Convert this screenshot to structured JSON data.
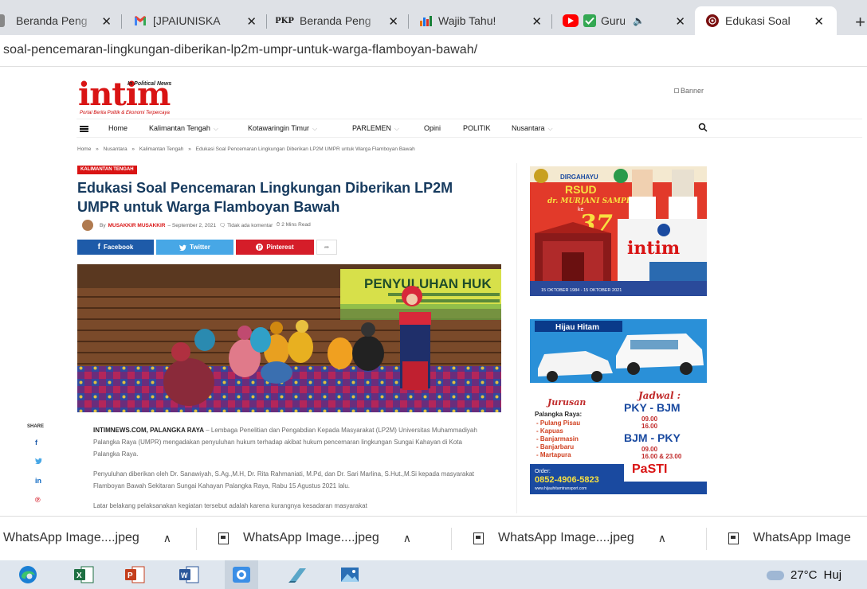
{
  "browser": {
    "tabs": [
      {
        "title": "Beranda Peng",
        "favicon": "gear-icon",
        "color": "#888888"
      },
      {
        "title": "[JPAIUNISKA",
        "favicon": "gmail-icon",
        "color": "#ea4335"
      },
      {
        "title": "Beranda Peng",
        "favicon": "pkp-icon",
        "favicon_text": "PKP",
        "color": "#222222"
      },
      {
        "title": "Wajib Tahu!",
        "favicon": "chart-icon",
        "color": "#e8710a"
      },
      {
        "title": "Guru",
        "favicon": "youtube-icon",
        "color": "#ff0000",
        "sound": "🔈"
      },
      {
        "title": "Edukasi Soal",
        "favicon": "site-icon",
        "color": "#7a1010"
      }
    ],
    "close_glyph": "✕",
    "new_tab_glyph": "+",
    "url": "soal-pencemaran-lingkungan-diberikan-lp2m-umpr-untuk-warga-flamboyan-bawah/"
  },
  "site": {
    "logo_text": "intim",
    "logo_small": "In Political News",
    "logo_tagline": "Portal Berita Politik & Ekonomi Terpercaya",
    "banner_alt": "Banner",
    "nav": [
      {
        "label": "Home",
        "caret": false
      },
      {
        "label": "Kalimantan Tengah",
        "caret": true
      },
      {
        "label": "Kotawaringin Timur",
        "caret": true
      },
      {
        "label": "PARLEMEN",
        "caret": true
      },
      {
        "label": "Opini",
        "caret": false
      },
      {
        "label": "POLITIK",
        "caret": false
      },
      {
        "label": "Nusantara",
        "caret": true
      }
    ],
    "nav_caret": "⌵"
  },
  "article": {
    "breadcrumb": [
      "Home",
      "»",
      "Nusantara",
      "»",
      "Kalimantan Tengah",
      "»",
      "Edukasi Soal Pencemaran Lingkungan Diberikan LP2M UMPR untuk Warga Flamboyan Bawah"
    ],
    "category": "KALIMANTAN TENGAH",
    "title": "Edukasi Soal Pencemaran Lingkungan Diberikan LP2M UMPR untuk Warga Flamboyan Bawah",
    "by": "By",
    "author": "MUSAKKIR MUSAKKIR",
    "date": "– September 2, 2021",
    "comments": "🗨 Tidak ada komentar",
    "read_time": "⏱ 2 Mins Read",
    "share": {
      "facebook": "Facebook",
      "twitter": "Twitter",
      "pinterest": "Pinterest",
      "more": "➦"
    },
    "share_column_label": "SHARE",
    "share_column": [
      {
        "name": "facebook",
        "glyph": "f",
        "color": "#1e5ba9"
      },
      {
        "name": "twitter",
        "glyph": "🐦",
        "color": "#47a7e6"
      },
      {
        "name": "linkedin",
        "glyph": "in",
        "color": "#0a66c2"
      },
      {
        "name": "pinterest",
        "glyph": "℗",
        "color": "#d51d29"
      }
    ],
    "photo_banner_text": "PENYULUHAN HUK",
    "lead_source": "INTIMNEWS.COM, PALANGKA RAYA",
    "para1": " – Lembaga Penelitian dan Pengabdian Kepada Masyarakat (LP2M) Universitas Muhammadiyah Palangka Raya (UMPR) mengadakan penyuluhan hukum terhadap akibat hukum pencemaran lingkungan Sungai Kahayan di Kota Palangka Raya.",
    "para2": "Penyuluhan diberikan oleh Dr. Sanawiyah, S.Ag.,M.H, Dr. Rita Rahmaniati, M.Pd, dan Dr. Sari Marlina, S.Hut.,M.Si kepada masyarakat Flamboyan Bawah Sekitaran Sungai Kahayan Palangka Raya, Rabu 15 Agustus 2021 lalu.",
    "para3": "Latar belakang pelaksanakan kegiatan tersebut adalah karena kurangnya kesadaran masyarakat"
  },
  "ads": {
    "ad1": {
      "line1": "DIRGAHAYU",
      "line2": "RSUD",
      "line3": "dr. MURJANI SAMPIT",
      "ke": "ke",
      "number": "37",
      "brand": "intim",
      "dates": "15 OKTOBER 1984 - 15 OKTOBER 2021"
    },
    "ad2": {
      "brand": "Hijau Hitam",
      "jurusan": "Jurusan",
      "from": "Palangka Raya:",
      "routes": [
        "- Pulang Pisau",
        "- Kapuas",
        "- Banjarmasin",
        "- Banjarbaru",
        "- Martapura"
      ],
      "jadwal": "Jadwal :",
      "route1": "PKY - BJM",
      "route1_times": [
        "09.00",
        "16.00"
      ],
      "route2": "BJM - PKY",
      "route2_times": [
        "09.00",
        "16.00 & 23.00"
      ],
      "pasti": "PaSTI",
      "order_label": "Order:",
      "phone": "0852-4906-5823",
      "web": "www.hijauhitamtransport.com"
    }
  },
  "downloads": [
    {
      "name": "WhatsApp Image....jpeg"
    },
    {
      "name": "WhatsApp Image....jpeg"
    },
    {
      "name": "WhatsApp Image....jpeg"
    },
    {
      "name": "WhatsApp Image"
    }
  ],
  "download_chevron": "∧",
  "taskbar": {
    "apps": [
      {
        "name": "edge-icon",
        "color": "#1a7fd4"
      },
      {
        "name": "excel-icon",
        "color": "#1d6f42",
        "letter": "X"
      },
      {
        "name": "powerpoint-icon",
        "color": "#c43e1c",
        "letter": "P"
      },
      {
        "name": "word-icon",
        "color": "#2b579a",
        "letter": "W"
      },
      {
        "name": "camera-icon",
        "color": "#3a8ee6"
      },
      {
        "name": "notepad-icon",
        "color": "#5aa6c8"
      },
      {
        "name": "photos-icon",
        "color": "#2a6fb5"
      }
    ],
    "temperature": "27°C",
    "weather_text": "Huj"
  }
}
